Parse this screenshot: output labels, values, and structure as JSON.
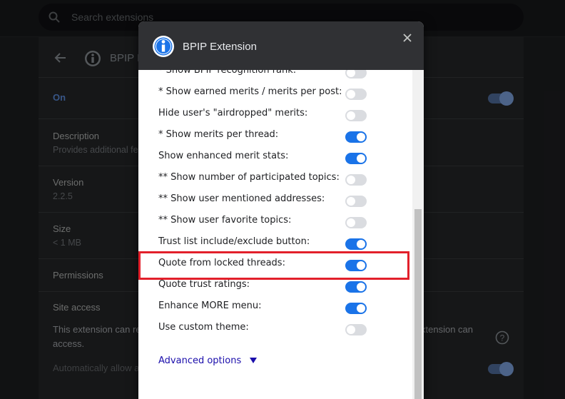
{
  "search": {
    "placeholder": "Search extensions"
  },
  "background": {
    "ext_name": "BPIP E",
    "status": "On",
    "description_label": "Description",
    "description_value": "Provides additional fe",
    "version_label": "Version",
    "version_value": "2.2.5",
    "size_label": "Size",
    "size_value": "< 1 MB",
    "permissions_label": "Permissions",
    "site_access_label": "Site access",
    "site_access_text": "This extension can re",
    "site_access_text_right": "xtension can",
    "site_access_text2": "access.",
    "auto_allow_text": "Automatically allow a"
  },
  "dialog": {
    "title": "BPIP Extension",
    "options": [
      {
        "label": "* Show BPIP recognition rank:",
        "on": false
      },
      {
        "label": "* Show earned merits / merits per post:",
        "on": false
      },
      {
        "label": "Hide user's \"airdropped\" merits:",
        "on": false
      },
      {
        "label": "* Show merits per thread:",
        "on": true
      },
      {
        "label": "Show enhanced merit stats:",
        "on": true
      },
      {
        "label": "** Show number of participated topics:",
        "on": false
      },
      {
        "label": "** Show user mentioned addresses:",
        "on": false
      },
      {
        "label": "** Show user favorite topics:",
        "on": false
      },
      {
        "label": "Trust list include/exclude button:",
        "on": true
      },
      {
        "label": "Quote from locked threads:",
        "on": true
      },
      {
        "label": "Quote trust ratings:",
        "on": true
      },
      {
        "label": "Enhance MORE menu:",
        "on": true
      },
      {
        "label": "Use custom theme:",
        "on": false
      }
    ],
    "advanced_label": "Advanced options"
  },
  "colors": {
    "toggle_on": "#1a73e8",
    "toggle_off": "#dadce0",
    "highlight": "#e2202b",
    "link": "#1a0dab"
  }
}
